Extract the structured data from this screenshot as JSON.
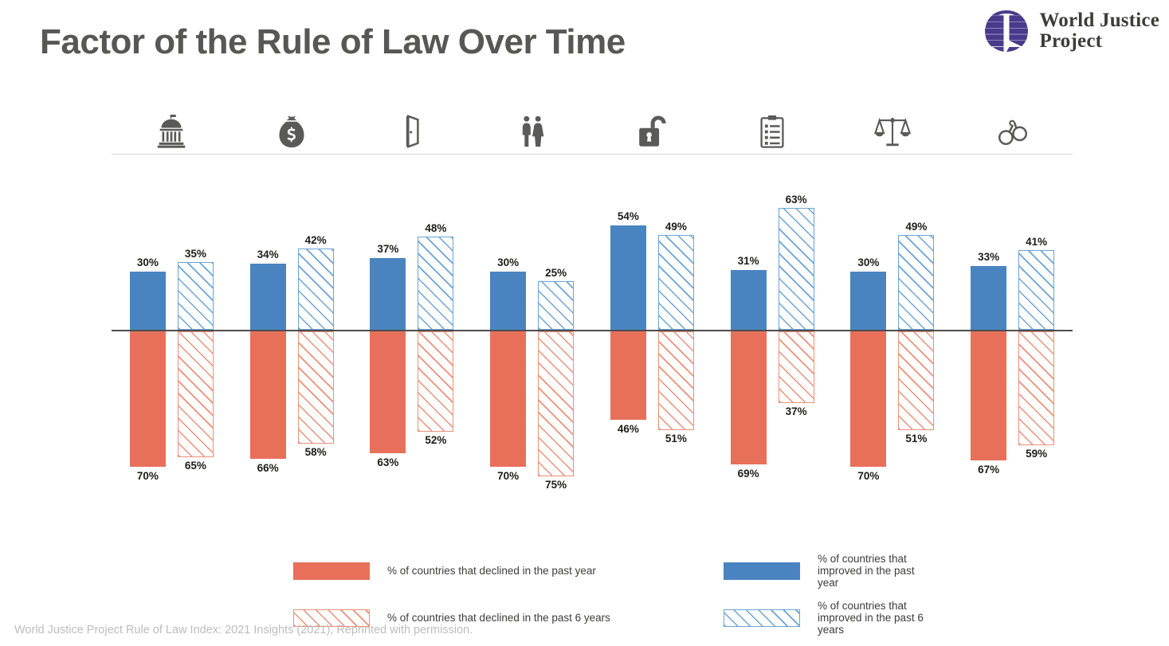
{
  "header": {
    "title": "Factor of the Rule of Law Over Time",
    "logo_line1": "World Justice",
    "logo_line2": "Project",
    "logo_icon": "globe-icon",
    "logo_color": "#4a3a8c"
  },
  "footer": {
    "caption": "World Justice Project Rule of Law Index: 2021 Insights (2021), Reprinted with permission."
  },
  "legend": {
    "items": [
      {
        "key": "declined_year",
        "swatch": "solid-orange",
        "label": "% of countries that declined in the past year"
      },
      {
        "key": "improved_year",
        "swatch": "solid-blue",
        "label": "% of countries that improved in the past year"
      },
      {
        "key": "declined_6years",
        "swatch": "hatch-orange",
        "label": "% of countries that declined in the past 6 years"
      },
      {
        "key": "improved_6years",
        "swatch": "hatch-blue",
        "label": "% of countries that improved in the past 6 years"
      }
    ]
  },
  "chart_data": {
    "type": "bar",
    "title": "Factor of the Rule of Law Over Time",
    "xlabel": "",
    "ylabel": "",
    "ylim": [
      -100,
      100
    ],
    "grid": false,
    "legend_position": "bottom",
    "orientation": "diverging-vertical",
    "zero_line": 0,
    "value_suffix": "%",
    "categories": [
      "Constraints on\nGovernment Powers",
      "Absence of\nCorruption",
      "Open\nGovernment",
      "Fundamental\nRights",
      "Order\nand Security",
      "Regulatory\nEnforcement",
      "Civil\nJustice",
      "Criminal\nJustice"
    ],
    "category_icons": [
      "capitol-building-icon",
      "money-bag-icon",
      "open-door-icon",
      "two-people-icon",
      "open-padlock-icon",
      "clipboard-icon",
      "scales-of-justice-icon",
      "handcuffs-icon"
    ],
    "series": [
      {
        "name": "% of countries that improved in the past year",
        "key": "improved_year",
        "color": "#4a84c0",
        "style": "solid",
        "direction": "up",
        "values": [
          30,
          34,
          37,
          30,
          54,
          31,
          30,
          33
        ]
      },
      {
        "name": "% of countries that improved in the past 6 years",
        "key": "improved_6years",
        "color": "#6ba3d6",
        "style": "hatch",
        "direction": "up",
        "values": [
          35,
          42,
          48,
          25,
          49,
          63,
          49,
          41
        ]
      },
      {
        "name": "% of countries that declined in the past year",
        "key": "declined_year",
        "color": "#e8705a",
        "style": "solid",
        "direction": "down",
        "values": [
          70,
          66,
          63,
          70,
          46,
          69,
          70,
          67
        ]
      },
      {
        "name": "% of countries that declined in the past 6 years",
        "key": "declined_6years",
        "color": "#ec9079",
        "style": "hatch",
        "direction": "down",
        "values": [
          65,
          58,
          52,
          75,
          51,
          37,
          51,
          59
        ]
      }
    ],
    "labels": {
      "improved_year": [
        "30%",
        "34%",
        "37%",
        "30%",
        "54%",
        "31%",
        "30%",
        "33%"
      ],
      "improved_6years": [
        "35%",
        "42%",
        "48%",
        "25%",
        "49%",
        "63%",
        "49%",
        "41%"
      ],
      "declined_year": [
        "70%",
        "66%",
        "63%",
        "70%",
        "46%",
        "69%",
        "70%",
        "67%"
      ],
      "declined_6years": [
        "65%",
        "58%",
        "52%",
        "75%",
        "51%",
        "37%",
        "51%",
        "59%"
      ]
    }
  },
  "colors": {
    "blue_solid": "#4a84c0",
    "blue_hatch": "#6ba3d6",
    "orange_solid": "#e8705a",
    "orange_hatch": "#ec9079",
    "title_gray": "#575756",
    "brand_purple": "#4a3a8c"
  }
}
